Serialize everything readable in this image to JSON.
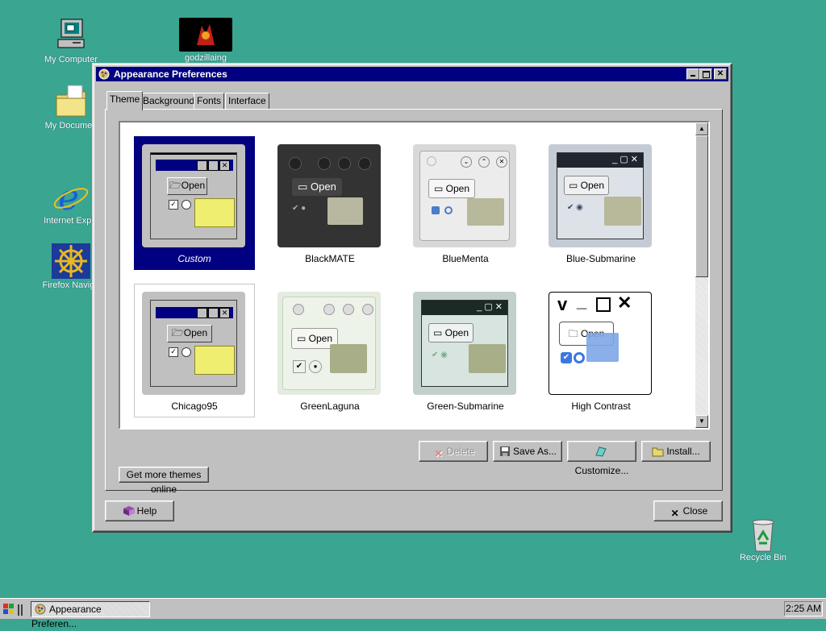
{
  "desktop": {
    "icons": [
      {
        "label": "My Computer",
        "icon": "computer-icon"
      },
      {
        "label": "godzillaing",
        "icon": "image-icon"
      },
      {
        "label": "My Documen",
        "icon": "folder-icon"
      },
      {
        "label": "Internet Explo",
        "icon": "ie-icon"
      },
      {
        "label": "Firefox Naviga",
        "icon": "ship-wheel-icon"
      },
      {
        "label": "Recycle Bin",
        "icon": "recycle-bin-icon"
      }
    ],
    "background_color": "#3aa590"
  },
  "window": {
    "title": "Appearance Preferences",
    "tabs": [
      "Theme",
      "Background",
      "Fonts",
      "Interface"
    ],
    "active_tab": "Theme",
    "themes": [
      {
        "name": "Custom",
        "selected": true
      },
      {
        "name": "BlackMATE"
      },
      {
        "name": "BlueMenta"
      },
      {
        "name": "Blue-Submarine"
      },
      {
        "name": "Chicago95"
      },
      {
        "name": "GreenLaguna"
      },
      {
        "name": "Green-Submarine"
      },
      {
        "name": "High Contrast"
      }
    ],
    "preview_open_label": "Open",
    "buttons": {
      "delete": "Delete",
      "save_as": "Save As...",
      "customize": "Customize...",
      "install": "Install...",
      "get_more": "Get more themes online",
      "help": "Help",
      "close": "Close"
    }
  },
  "taskbar": {
    "task": "Appearance Preferen...",
    "clock": "2:25 AM"
  },
  "colors": {
    "titlebar": "#000080",
    "selection": "#000080",
    "face": "#c0c0c0"
  }
}
